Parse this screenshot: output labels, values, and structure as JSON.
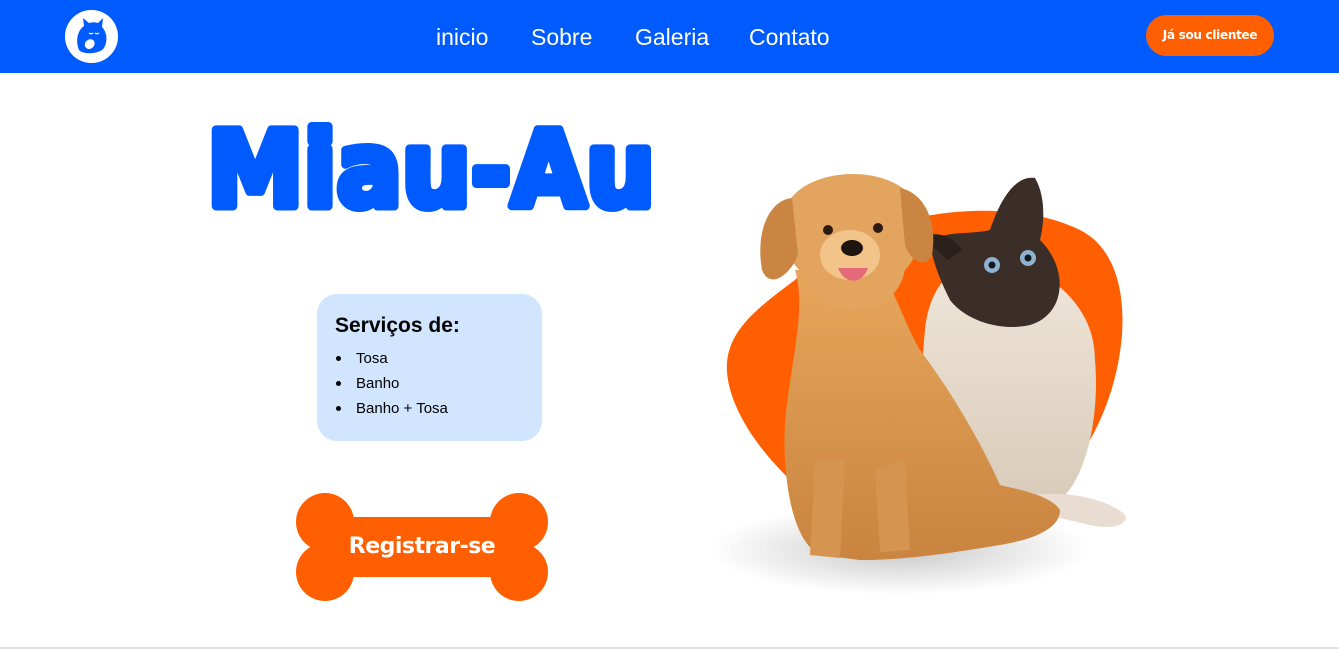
{
  "brand": {
    "logo_icon": "cat-dog-logo-icon",
    "title": "Miau-Au"
  },
  "nav": {
    "links": [
      {
        "label": "inicio"
      },
      {
        "label": "Sobre"
      },
      {
        "label": "Galeria"
      },
      {
        "label": "Contato"
      }
    ],
    "client_button_label": "Já sou clientee"
  },
  "services": {
    "title": "Serviços de:",
    "items": [
      "Tosa",
      "Banho",
      "Banho + Tosa"
    ]
  },
  "cta": {
    "register_label": "Registrar-se",
    "shape_icon": "bone-icon"
  },
  "hero_image": {
    "subject": "dog-and-cat-photo"
  },
  "colors": {
    "primary_blue": "#005bff",
    "accent_orange": "#ff5f00",
    "card_bg": "#d2e5ff",
    "white": "#ffffff"
  }
}
